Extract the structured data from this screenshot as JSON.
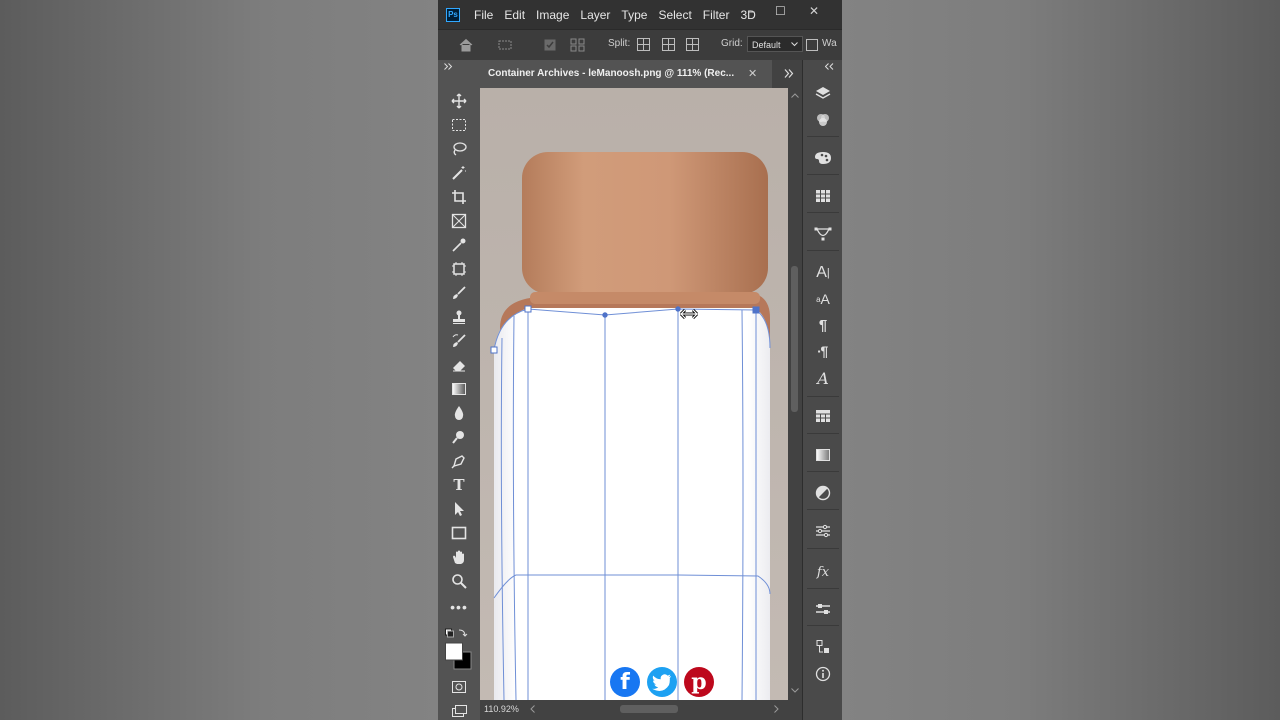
{
  "menubar": {
    "logo": "Ps",
    "items": [
      "File",
      "Edit",
      "Image",
      "Layer",
      "Type",
      "Select",
      "Filter",
      "3D"
    ],
    "window_controls": [
      "–",
      "☐",
      "✕"
    ]
  },
  "options_bar": {
    "split_label": "Split:",
    "grid_label": "Grid:",
    "grid_value": "Default",
    "warp_label": "Wa"
  },
  "document": {
    "tab_title": "Container Archives - leManoosh.png @ 111% (Rec...",
    "close_glyph": "✕"
  },
  "status": {
    "zoom": "110.92%"
  },
  "colors": {
    "accent": "#31a8ff",
    "facebook": "#1877f2",
    "twitter": "#1da1f2",
    "pinterest": "#bd081c",
    "warp_mesh": "#6f8fd6"
  },
  "icons": {
    "toolbar": [
      "move-icon",
      "marquee-icon",
      "lasso-icon",
      "magic-wand-icon",
      "crop-icon",
      "frame-icon",
      "eyedropper-icon",
      "patch-icon",
      "brush-icon",
      "stamp-icon",
      "history-brush-icon",
      "eraser-icon",
      "gradient-icon",
      "blur-icon",
      "dodge-icon",
      "pen-icon",
      "type-icon",
      "path-selection-icon",
      "rectangle-icon",
      "hand-icon",
      "zoom-icon",
      "more-tools-icon"
    ],
    "dock": [
      "layers-icon",
      "channels-icon",
      "color-icon",
      "swatches-icon",
      "paths-icon",
      "character-icon",
      "character-styles-icon",
      "paragraph-icon",
      "paragraph-styles-icon",
      "glyphs-icon",
      "table-icon",
      "gradients-icon",
      "adjustments-icon",
      "properties-icon",
      "styles-icon",
      "libraries-icon",
      "history-icon",
      "info-icon"
    ]
  }
}
